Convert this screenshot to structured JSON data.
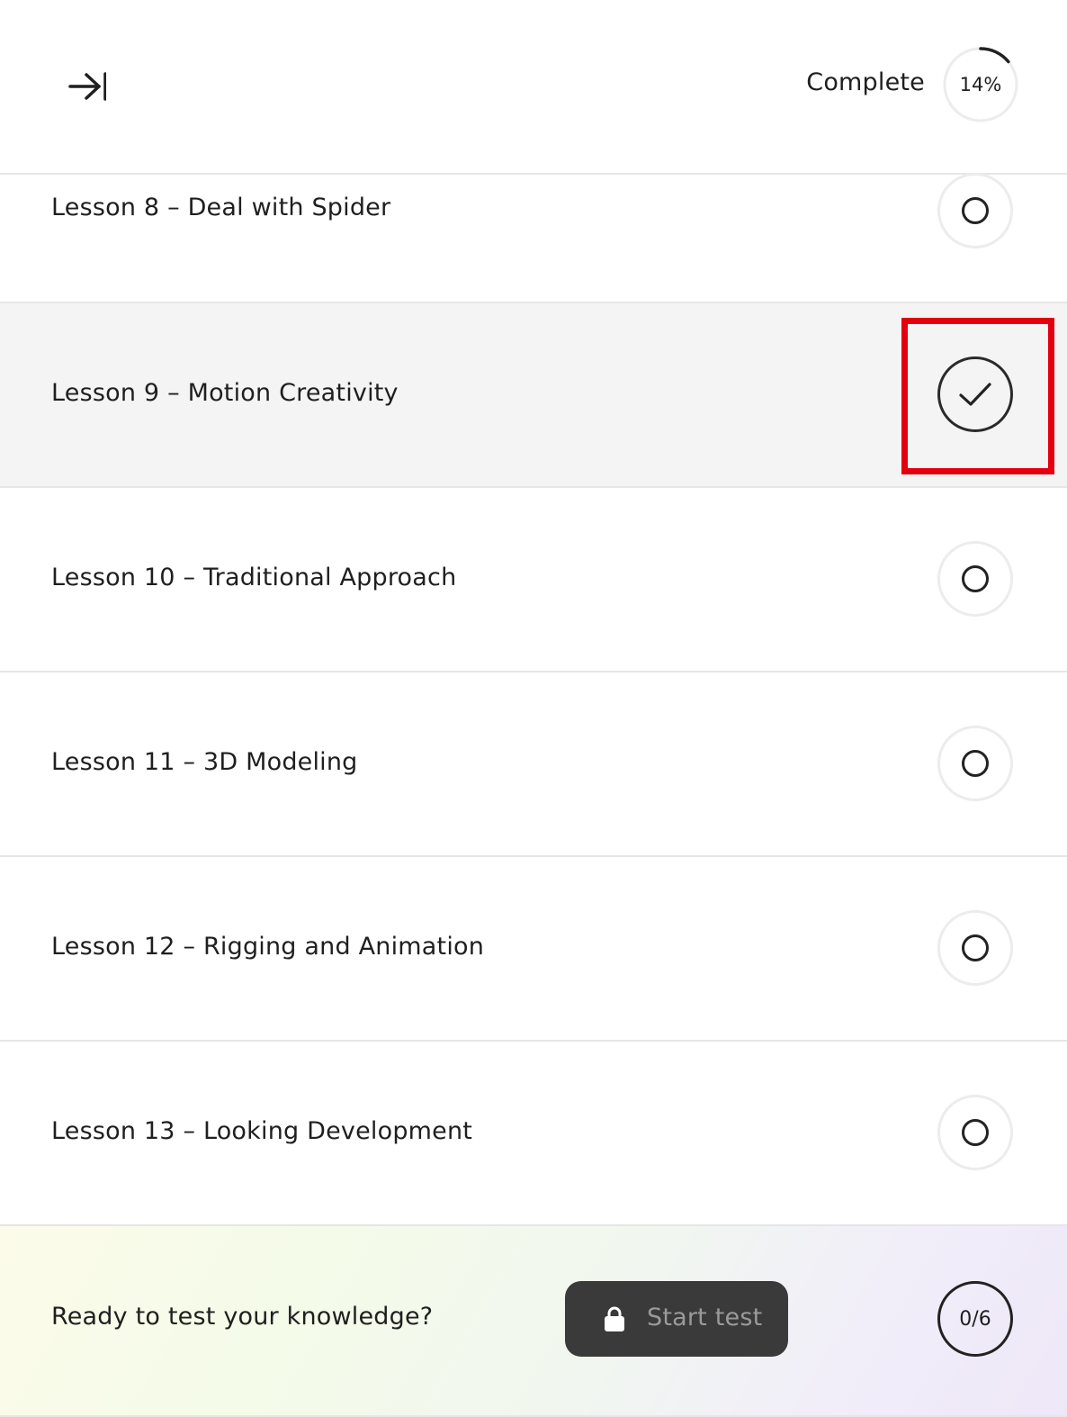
{
  "header": {
    "collapse_icon": "arrow-right-to-bar-icon",
    "complete_label": "Complete",
    "progress_text": "14%",
    "progress_value": 0.14
  },
  "lessons": [
    {
      "title": "Lesson 8 – Deal with Spider",
      "completed": false
    },
    {
      "title": "Lesson 9 – Motion Creativity",
      "completed": true,
      "selected": true
    },
    {
      "title": "Lesson 10 – Traditional Approach",
      "completed": false
    },
    {
      "title": "Lesson 11 – 3D Modeling",
      "completed": false
    },
    {
      "title": "Lesson 12 – Rigging and Animation",
      "completed": false
    },
    {
      "title": "Lesson 13 – Looking Development",
      "completed": false
    }
  ],
  "footer": {
    "prompt": "Ready to test your knowledge?",
    "start_button_label": "Start test",
    "lock_icon": "lock-icon",
    "score": "0/6"
  },
  "colors": {
    "highlight": "#e3000f",
    "button_bg": "#3a3a3a",
    "active_row_bg": "#f4f4f4"
  }
}
